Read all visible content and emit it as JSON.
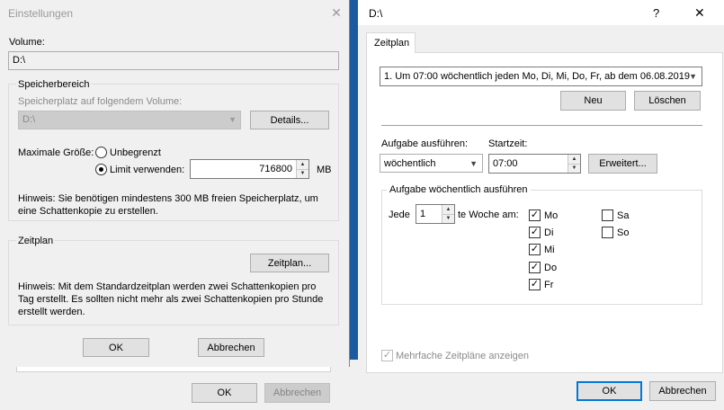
{
  "left": {
    "title": "Einstellungen",
    "volume_label": "Volume:",
    "volume_value": "D:\\",
    "storage": {
      "group_title": "Speicherbereich",
      "on_volume_label": "Speicherplatz auf folgendem Volume:",
      "on_volume_value": "D:\\",
      "details_button": "Details...",
      "max_size_label": "Maximale Größe:",
      "unlimited_label": "Unbegrenzt",
      "limit_label": "Limit verwenden:",
      "limit_value": "716800",
      "unit": "MB",
      "hint": "Hinweis: Sie benötigen mindestens 300 MB freien Speicherplatz, um eine Schattenkopie zu erstellen."
    },
    "schedule": {
      "group_title": "Zeitplan",
      "button": "Zeitplan...",
      "hint": "Hinweis: Mit dem Standardzeitplan werden zwei Schattenkopien pro Tag erstellt. Es sollten nicht mehr als zwei Schattenkopien pro Stunde erstellt werden."
    },
    "ok_button": "OK",
    "cancel_button": "Abbrechen",
    "back_ok_button": "OK",
    "back_cancel_button": "Abbrechen"
  },
  "right": {
    "title": "D:\\",
    "help_glyph": "?",
    "close_glyph": "✕",
    "tab_label": "Zeitplan",
    "schedule_select": "1. Um 07:00 wöchentlich jeden Mo, Di, Mi, Do, Fr, ab dem 06.08.2019",
    "new_button": "Neu",
    "delete_button": "Löschen",
    "task_label": "Aufgabe ausführen:",
    "task_value": "wöchentlich",
    "start_label": "Startzeit:",
    "start_value": "07:00",
    "advanced_button": "Erweitert...",
    "weekly_group": "Aufgabe wöchentlich ausführen",
    "every_label": "Jede",
    "every_value": "1",
    "week_on_label": "te Woche am:",
    "days": [
      {
        "label": "Mo",
        "checked": true
      },
      {
        "label": "Di",
        "checked": true
      },
      {
        "label": "Mi",
        "checked": true
      },
      {
        "label": "Do",
        "checked": true
      },
      {
        "label": "Fr",
        "checked": true
      },
      {
        "label": "Sa",
        "checked": false
      },
      {
        "label": "So",
        "checked": false
      }
    ],
    "multi_label": "Mehrfache Zeitpläne anzeigen",
    "ok_button": "OK",
    "cancel_button": "Abbrechen"
  },
  "icons": {
    "close": "close-icon",
    "dropdown": "chevron-down-icon",
    "check": "checkmark-icon"
  }
}
